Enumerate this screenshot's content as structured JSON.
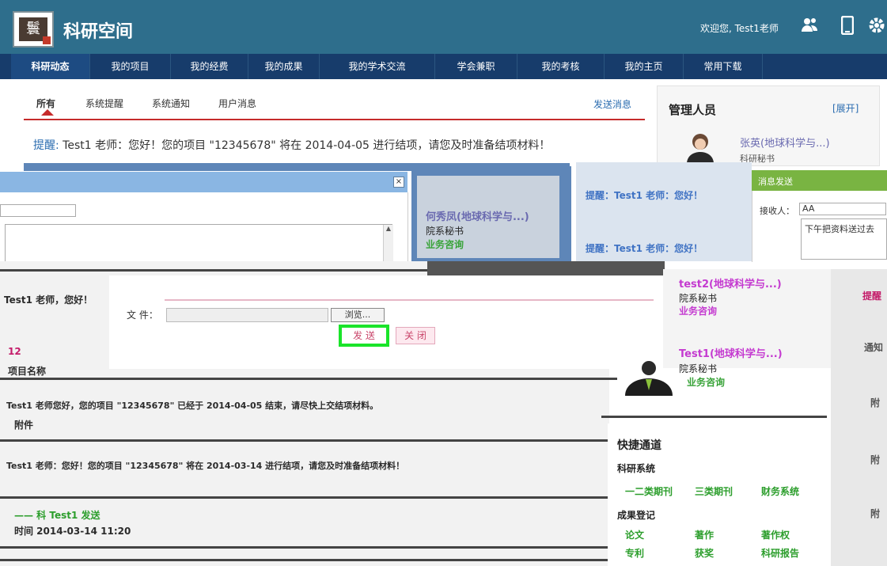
{
  "header": {
    "app_title": "科研空间",
    "logo_glyph": "鬟",
    "welcome": "欢迎您, Test1老师",
    "icons": [
      "users-icon",
      "mobile-icon",
      "gear-icon"
    ]
  },
  "nav": {
    "items": [
      "科研动态",
      "我的项目",
      "我的经费",
      "我的成果",
      "我的学术交流",
      "学会兼职",
      "我的考核",
      "我的主页",
      "常用下载"
    ]
  },
  "subtabs": {
    "items": [
      "所有",
      "系统提醒",
      "系统通知",
      "用户消息"
    ],
    "send_message": "发送消息"
  },
  "notice": {
    "label": "提醒:",
    "text": "Test1 老师：您好！您的项目 \"12345678\" 将在 2014-04-05 进行结项，请您及时准备结项材料！"
  },
  "admin": {
    "title": "管理人员",
    "expand": "[展开]",
    "name": "张英(地球科学与...)",
    "sub": "科研秘书"
  },
  "compose": {
    "close_glyph": "×"
  },
  "attach": {
    "file_label": "文 件：",
    "browse": "浏览...",
    "send": "发 送",
    "close": "关 闭"
  },
  "right_list": {
    "name1": "何秀凤(地球科学与...)",
    "role1": "院系秘书",
    "tag1": "业务咨询",
    "name2": "test2(地球科学与...)",
    "role2": "院系秘书",
    "tag2": "业务咨询",
    "name3": "Test1(地球科学与...)",
    "role3": "院系秘书",
    "tag3": "业务咨询",
    "remind1": "提醒：Test1 老师：您好！",
    "remind2": "提醒：Test1 老师：您好！"
  },
  "msgsend": {
    "title": "消息发送",
    "recipient_label": "接收人：",
    "recipient_value": "AA",
    "content": "下午把资料送过去"
  },
  "quick": {
    "title": "快捷通道",
    "section1": "科研系统",
    "links1": [
      "一二类期刊",
      "三类期刊",
      "财务系统"
    ],
    "section2": "成果登记",
    "links2": [
      "论文",
      "著作",
      "著作权",
      "专利",
      "获奖",
      "科研报告"
    ]
  },
  "left_lines": {
    "greeting": "Test1 老师，您好！",
    "num": "12",
    "line1": "项目名称",
    "line2": "Test1 老师您好，您的项目 \"12345678\" 已经于 2014-04-05 结束，请尽快上交结项材料。",
    "line3": "附件",
    "line4": "Test1 老师：您好！您的项目 \"12345678\" 将在 2014-03-14 进行结项，请您及时准备结项材料！",
    "line5": "—— 科 Test1 发送",
    "line6": "时间 2014-03-14 11:20"
  },
  "side_right": {
    "items": [
      "提醒",
      "通知",
      "附",
      "附",
      "附"
    ]
  }
}
